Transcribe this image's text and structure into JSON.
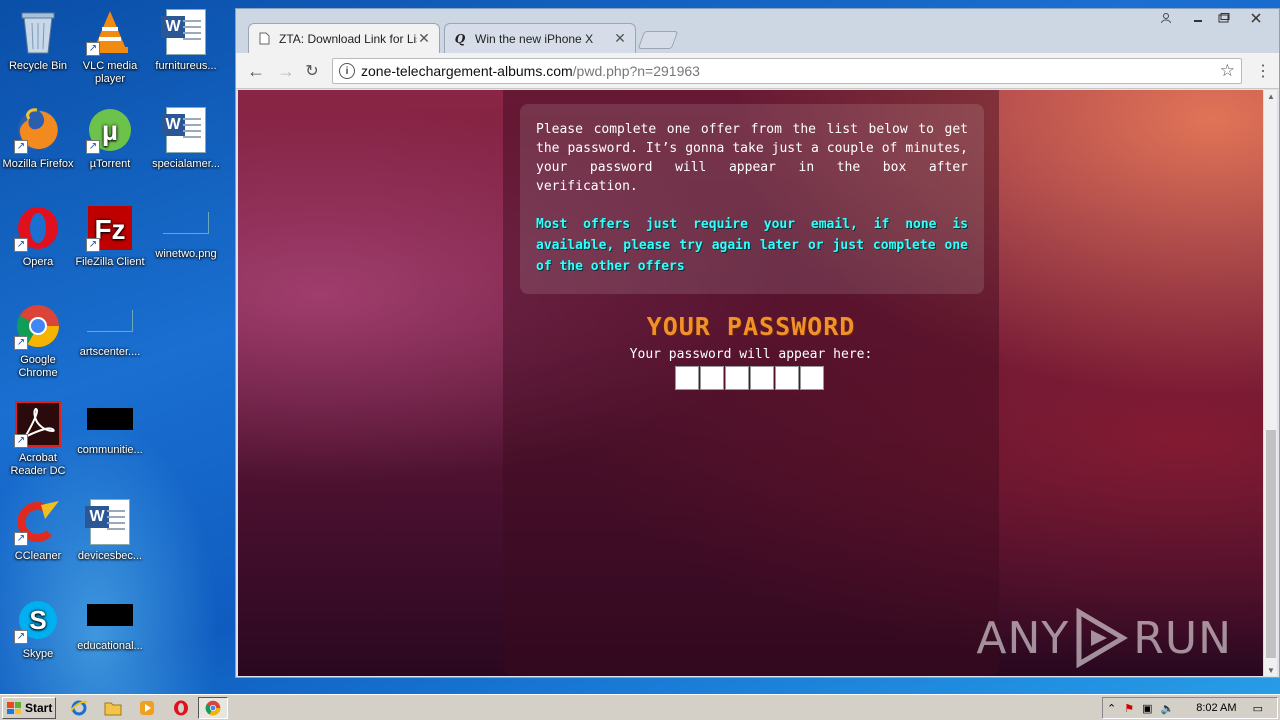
{
  "desktop": {
    "icons": [
      {
        "label": "Recycle Bin",
        "icon": "recycle-bin-icon"
      },
      {
        "label": "VLC media player",
        "icon": "vlc-icon"
      },
      {
        "label": "furnitureus...",
        "icon": "word-doc-icon"
      },
      {
        "label": "Mozilla Firefox",
        "icon": "firefox-icon"
      },
      {
        "label": "µTorrent",
        "icon": "utorrent-icon"
      },
      {
        "label": "specialamer...",
        "icon": "word-doc-icon"
      },
      {
        "label": "Opera",
        "icon": "opera-icon"
      },
      {
        "label": "FileZilla Client",
        "icon": "filezilla-icon"
      },
      {
        "label": "winetwo.png",
        "icon": "image-file-icon"
      },
      {
        "label": "Google Chrome",
        "icon": "chrome-icon"
      },
      {
        "label": "artscenter....",
        "icon": "image-file-icon"
      },
      {
        "label": "Acrobat Reader DC",
        "icon": "acrobat-icon"
      },
      {
        "label": "communitie...",
        "icon": "black-file-icon"
      },
      {
        "label": "CCleaner",
        "icon": "ccleaner-icon"
      },
      {
        "label": "devicesbec...",
        "icon": "word-doc-icon"
      },
      {
        "label": "Skype",
        "icon": "skype-icon"
      },
      {
        "label": "educational...",
        "icon": "black-file-icon"
      }
    ]
  },
  "browser": {
    "tabs": [
      {
        "title": "ZTA: Download Link for Lisa",
        "icon": "page-icon"
      },
      {
        "title": "Win the new iPhone X",
        "icon": "q-favicon-icon"
      }
    ],
    "url_host": "zone-telechargement-albums.com",
    "url_path": "/pwd.php?n=291963"
  },
  "page": {
    "instructions": "Please complete one offer from the list below to get the password. It’s gonna take just a couple of minutes, your password will appear in the box after verification.",
    "highlight": "Most offers just require your email, if none is available, please try again later or just complete one of the other offers",
    "password_title": "YOUR PASSWORD",
    "password_sub": "Your password will appear here:",
    "password_box_count": 6
  },
  "watermark": {
    "left": "ANY",
    "right": "RUN"
  },
  "taskbar": {
    "start_label": "Start",
    "clock": "8:02 AM"
  },
  "colors": {
    "highlight_text": "#33ffff",
    "password_title": "#f2902a",
    "desktop_bg": "#1a6fd0"
  }
}
